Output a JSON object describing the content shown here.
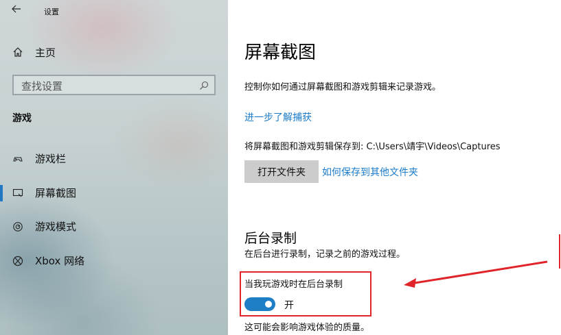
{
  "window": {
    "title": "设置"
  },
  "sidebar": {
    "home_label": "主页",
    "search_placeholder": "查找设置",
    "section_heading": "游戏",
    "items": [
      {
        "label": "游戏栏",
        "icon": "game-controller-icon",
        "active": false
      },
      {
        "label": "屏幕截图",
        "icon": "capture-icon",
        "active": true
      },
      {
        "label": "游戏模式",
        "icon": "game-mode-icon",
        "active": false
      },
      {
        "label": "Xbox 网络",
        "icon": "xbox-icon",
        "active": false
      }
    ]
  },
  "main": {
    "title": "屏幕截图",
    "description": "控制你如何通过屏幕截图和游戏剪辑来记录游戏。",
    "learn_more_link": "进一步了解捕获",
    "save_path_text": "将屏幕截图和游戏剪辑保存到: C:\\Users\\靖宇\\Videos\\Captures",
    "open_folder_button": "打开文件夹",
    "save_elsewhere_link": "如何保存到其他文件夹",
    "background_recording": {
      "title": "后台录制",
      "description": "在后台进行录制，记录之前的游戏过程。",
      "toggle_label": "当我玩游戏时在后台录制",
      "toggle_state": "开",
      "toggle_on": true,
      "note": "这可能会影响游戏体验的质量。"
    }
  },
  "colors": {
    "accent": "#1e7ec6",
    "link": "#1b7ac7",
    "annotation": "#e0242a",
    "button_bg": "#cccccc"
  }
}
